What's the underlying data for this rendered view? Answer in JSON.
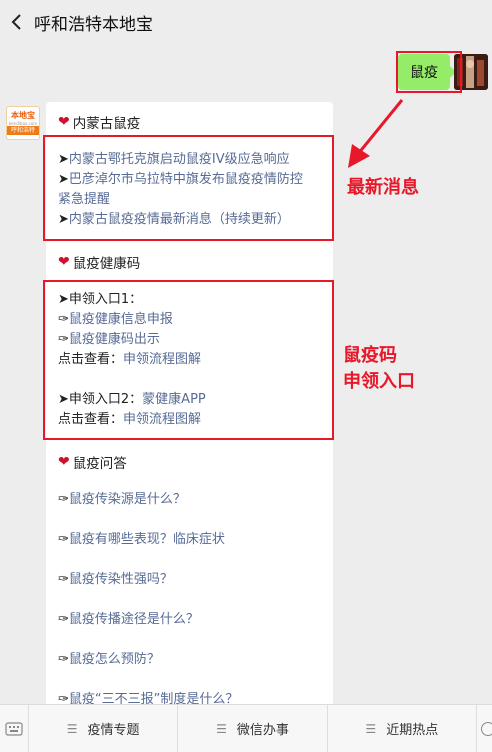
{
  "header": {
    "title": "呼和浩特本地宝"
  },
  "chat": {
    "user_message": "鼠疫",
    "bot_avatar": {
      "line1": "本地宝",
      "line2": "bendibao.com",
      "line3": "呼和浩特"
    },
    "sections": [
      {
        "title": "内蒙古鼠疫",
        "items": [
          {
            "arrow": "➤",
            "text": "内蒙古鄂托克旗启动鼠疫IV级应急响应"
          },
          {
            "arrow": "➤",
            "text": "巴彦淖尔市乌拉特中旗发布鼠疫疫情防控"
          },
          {
            "arrow": "",
            "text": "紧急提醒"
          },
          {
            "arrow": "➤",
            "text": "内蒙古鼠疫疫情最新消息（持续更新）"
          }
        ]
      },
      {
        "title": "鼠疫健康码",
        "items": [
          {
            "prefix": "➤申领入口1："
          },
          {
            "arrow": "✑",
            "text": "鼠疫健康信息申报"
          },
          {
            "arrow": "✑",
            "text": "鼠疫健康码出示"
          },
          {
            "prefix": "点击查看：",
            "text": "申领流程图解"
          },
          {
            "prefix": "➤申领入口2：",
            "text": "蒙健康APP"
          },
          {
            "prefix": "点击查看：",
            "text": "申领流程图解"
          }
        ]
      },
      {
        "title": "鼠疫问答",
        "items": [
          {
            "arrow": "✑",
            "text": "鼠疫传染源是什么？"
          },
          {
            "arrow": "✑",
            "text": "鼠疫有哪些表现？临床症状"
          },
          {
            "arrow": "✑",
            "text": "鼠疫传染性强吗？"
          },
          {
            "arrow": "✑",
            "text": "鼠疫传播途径是什么？"
          },
          {
            "arrow": "✑",
            "text": "鼠疫怎么预防？"
          },
          {
            "arrow": "✑",
            "text": "鼠疫“三不三报”制度是什么？"
          }
        ]
      }
    ]
  },
  "annotations": {
    "latest_label": "最新消息",
    "code_label_1": "鼠疫码",
    "code_label_2": "申领入口"
  },
  "bottom_menu": [
    {
      "label": "疫情专题"
    },
    {
      "label": "微信办事"
    },
    {
      "label": "近期热点"
    }
  ]
}
